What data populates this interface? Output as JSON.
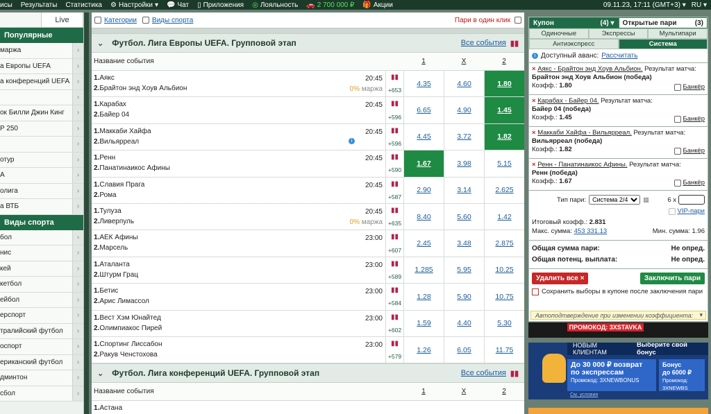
{
  "topnav": {
    "items": [
      "исы",
      "Результаты",
      "Статистика",
      "Настройки",
      "Чат",
      "Приложения",
      "Лояльность",
      "2 700 000 ₽",
      "Акции"
    ],
    "datetime": "09.11.23, 17:11 (GMT+3)",
    "lang": "RU"
  },
  "sidebar": {
    "tab_left": "",
    "tab_live": "Live",
    "popular_header": "Популярные",
    "popular": [
      "маржа",
      "а Европы UEFA",
      "а конференций UEFA",
      "",
      "ок Билли Джин Кинг",
      "P 250",
      "",
      "отур",
      "А",
      "олига",
      "а ВТБ"
    ],
    "sports_header": "Виды спорта",
    "sports": [
      "бол",
      "нис",
      "кей",
      "кетбол",
      "ейбол",
      "ерспорт",
      "тралийский футбол",
      "оспорт",
      "ериканский футбол",
      "дминтон",
      "сбол"
    ]
  },
  "filters": {
    "categories": "Категории",
    "sports": "Виды спорта",
    "oneclick": "Пари в один клик"
  },
  "section1": {
    "title": "Футбол. Лига Европы UEFA. Групповой этап",
    "all": "Все события",
    "col_name": "Название события",
    "col1": "1",
    "colx": "X",
    "col2": "2",
    "events": [
      {
        "t1": "Аякс",
        "t2": "Брайтон энд Хоув Альбион",
        "time": "20:45",
        "marzha": "0%",
        "marzha_label": "маржа",
        "more": "+653",
        "o1": "4.35",
        "ox": "4.60",
        "o2": "1.80",
        "sel": "2"
      },
      {
        "t1": "Карабах",
        "t2": "Байер 04",
        "time": "20:45",
        "more": "+596",
        "o1": "6.65",
        "ox": "4.90",
        "o2": "1.45",
        "sel": "2"
      },
      {
        "t1": "Маккаби Хайфа",
        "t2": "Вильярреал",
        "time": "20:45",
        "info": true,
        "more": "+596",
        "o1": "4.45",
        "ox": "3.72",
        "o2": "1.82",
        "sel": "2"
      },
      {
        "t1": "Ренн",
        "t2": "Панатинаикос Афины",
        "time": "20:45",
        "more": "+590",
        "o1": "1.67",
        "ox": "3.98",
        "o2": "5.15",
        "sel": "1"
      },
      {
        "t1": "Славия Прага",
        "t2": "Рома",
        "time": "20:45",
        "more": "+587",
        "o1": "2.90",
        "ox": "3.14",
        "o2": "2.625",
        "sel": ""
      },
      {
        "t1": "Тулуза",
        "t2": "Ливерпуль",
        "time": "20:45",
        "marzha": "0%",
        "marzha_label": "маржа",
        "more": "+635",
        "o1": "8.40",
        "ox": "5.60",
        "o2": "1.42",
        "sel": ""
      },
      {
        "t1": "АЕК Афины",
        "t2": "Марсель",
        "time": "23:00",
        "more": "+607",
        "o1": "2.45",
        "ox": "3.48",
        "o2": "2.875",
        "sel": ""
      },
      {
        "t1": "Аталанта",
        "t2": "Штурм Грац",
        "time": "23:00",
        "more": "+589",
        "o1": "1.285",
        "ox": "5.95",
        "o2": "10.25",
        "sel": ""
      },
      {
        "t1": "Бетис",
        "t2": "Арис Лимассол",
        "time": "23:00",
        "more": "+584",
        "o1": "1.28",
        "ox": "5.90",
        "o2": "10.75",
        "sel": ""
      },
      {
        "t1": "Вест Хэм Юнайтед",
        "t2": "Олимпиакос Пирей",
        "time": "23:00",
        "more": "+602",
        "o1": "1.59",
        "ox": "4.40",
        "o2": "5.30",
        "sel": ""
      },
      {
        "t1": "Спортинг Лиссабон",
        "t2": "Ракув Ченстохова",
        "time": "23:00",
        "more": "+579",
        "o1": "1.26",
        "ox": "6.05",
        "o2": "11.75",
        "sel": ""
      }
    ]
  },
  "section2": {
    "title": "Футбол. Лига конференций UEFA. Групповой этап",
    "all": "Все события",
    "col_name": "Название события",
    "col1": "1",
    "colx": "X",
    "col2": "2",
    "first_team": "Астана"
  },
  "coupon": {
    "tab_coupon": "Купон",
    "tab_coupon_count": "(4)",
    "tab_open": "Открытые пари",
    "tab_open_count": "(3)",
    "modes": [
      "Одиночные",
      "Экспрессы",
      "Мультипари",
      "Антиэкспресс",
      "Система"
    ],
    "avans_label": "Доступный аванс:",
    "avans_link": "Рассчитать",
    "bets": [
      {
        "title": "Аякс - Брайтон энд Хоув Альбион.",
        "market": "Результат матча:",
        "selection": "Брайтон энд Хоув Альбион (победа)",
        "coef": "1.80"
      },
      {
        "title": "Карабах - Байер 04.",
        "market": "Результат матча:",
        "selection": "Байер 04 (победа)",
        "coef": "1.45"
      },
      {
        "title": "Маккаби Хайфа - Вильярреал.",
        "market": "Результат матча:",
        "selection": "Вильярреал (победа)",
        "coef": "1.82"
      },
      {
        "title": "Ренн - Панатинаикос Афины.",
        "market": "Результат матча:",
        "selection": "Ренн (победа)",
        "coef": "1.67"
      }
    ],
    "coef_label": "Коэфф.:",
    "banker": "Банкёр",
    "type_label": "Тип пари:",
    "type_value": "Система 2/4",
    "mult": "6 x",
    "vip": "VIP-пари",
    "total_coef_label": "Итоговый коэфф.:",
    "total_coef": "2.831",
    "max_label": "Макс. сумма:",
    "max_value": "453 331.13",
    "min_label": "Мин. сумма:",
    "min_value": "1.96",
    "total_sum_label": "Общая сумма пари:",
    "total_sum_value": "Не опред.",
    "potential_label": "Общая потенц. выплата:",
    "potential_value": "Не опред.",
    "delete_all": "Удалить все",
    "place_bet": "Заключить пари",
    "keep_text": "Сохранить выборы в купоне после заключения пари",
    "autoconfirm": "Автоподтверждение при изменении коэффициента:"
  },
  "promo": {
    "code": "ПРОМОКОД: 3XSTAVKA",
    "new_clients": "НОВЫМ КЛИЕНТАМ",
    "choose": "Выберите свой бонус",
    "bonus1_title": "До 30 000 ₽ возврат",
    "bonus1_sub": "по экспрессам",
    "bonus1_code": "Промокод: 3XNEWBONUS",
    "bonus2_title": "Бонус",
    "bonus2_sub": "до 6000 ₽",
    "bonus2_code": "Промокод: 3XNEWBS",
    "terms": "См. условия"
  }
}
